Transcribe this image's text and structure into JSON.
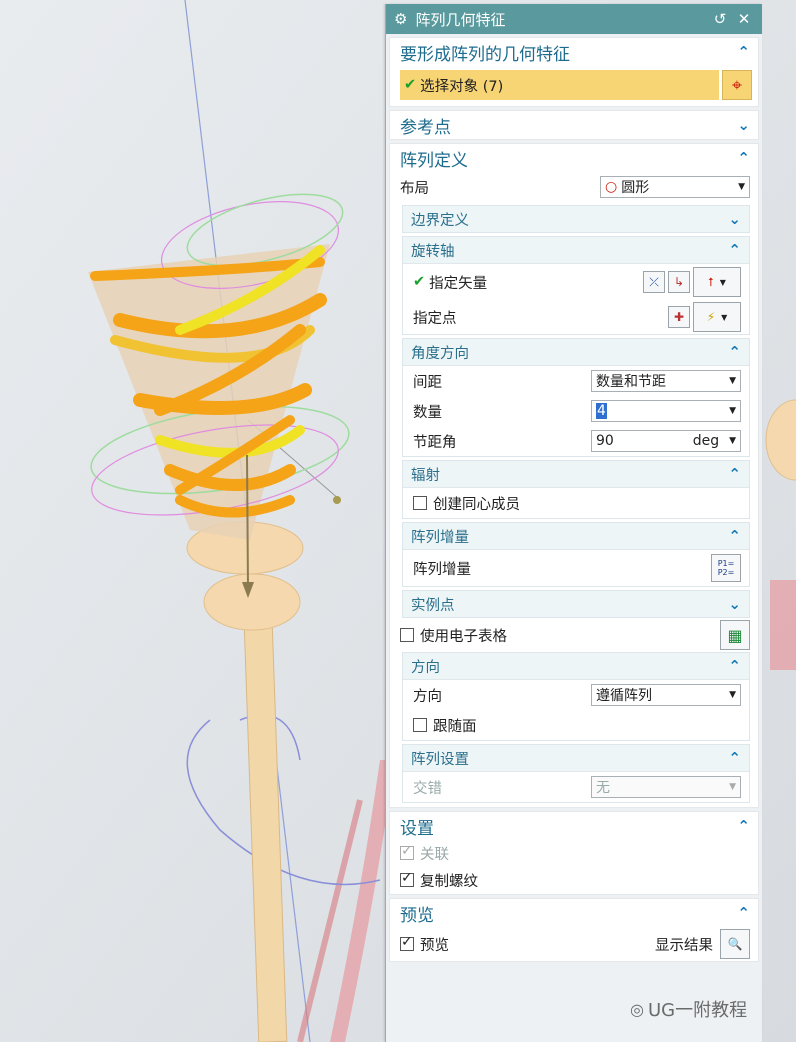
{
  "dialog": {
    "title": "阵列几何特征",
    "groups": {
      "geometry": {
        "title": "要形成阵列的几何特征",
        "select_label": "选择对象 (7)"
      },
      "reference": {
        "title": "参考点"
      },
      "definition": {
        "title": "阵列定义",
        "layout_label": "布局",
        "layout_value": "圆形",
        "boundary": {
          "title": "边界定义"
        },
        "axis": {
          "title": "旋转轴",
          "vector_label": "指定矢量",
          "point_label": "指定点"
        },
        "angle": {
          "title": "角度方向",
          "spacing_label": "间距",
          "spacing_value": "数量和节距",
          "count_label": "数量",
          "count_value": "4",
          "pitch_label": "节距角",
          "pitch_value": "90",
          "pitch_unit": "deg"
        },
        "radial": {
          "title": "辐射",
          "concentric_label": "创建同心成员",
          "concentric_checked": false
        },
        "increment": {
          "title": "阵列增量",
          "label": "阵列增量",
          "icon_text": "P1=\nP2="
        },
        "instance": {
          "title": "实例点"
        },
        "spreadsheet_label": "使用电子表格",
        "spreadsheet_checked": false,
        "orientation": {
          "title": "方向",
          "direction_label": "方向",
          "direction_value": "遵循阵列",
          "follow_face_label": "跟随面",
          "follow_face_checked": false
        },
        "settings_sub": {
          "title": "阵列设置",
          "stagger_label": "交错",
          "stagger_value": "无"
        }
      },
      "settings": {
        "title": "设置",
        "associative_label": "关联",
        "copy_thread_label": "复制螺纹"
      },
      "preview": {
        "title": "预览",
        "preview_label": "预览",
        "show_result_label": "显示结果"
      }
    }
  },
  "watermark": "UG一附教程",
  "colors": {
    "titlebar": "#5a9a9e",
    "highlight": "#f8d574",
    "accent": "#1778b8",
    "ribbon": "#f5a317"
  }
}
